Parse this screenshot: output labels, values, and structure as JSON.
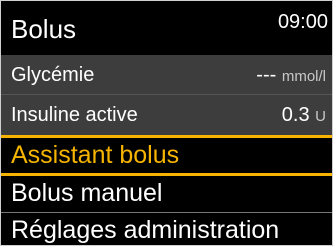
{
  "header": {
    "title": "Bolus",
    "time": "09:00"
  },
  "info": {
    "glycemia": {
      "label": "Glycémie",
      "value": "---",
      "unit": "mmol/l"
    },
    "active_insulin": {
      "label": "Insuline active",
      "value": "0.3",
      "unit": "U"
    }
  },
  "menu": {
    "items": [
      {
        "label": "Assistant bolus",
        "selected": true
      },
      {
        "label": "Bolus manuel",
        "selected": false
      },
      {
        "label": "Réglages administration",
        "selected": false
      }
    ]
  },
  "colors": {
    "accent": "#f6b400",
    "info_bg": "#3d3d3d",
    "bg": "#000000",
    "text": "#ffffff"
  }
}
